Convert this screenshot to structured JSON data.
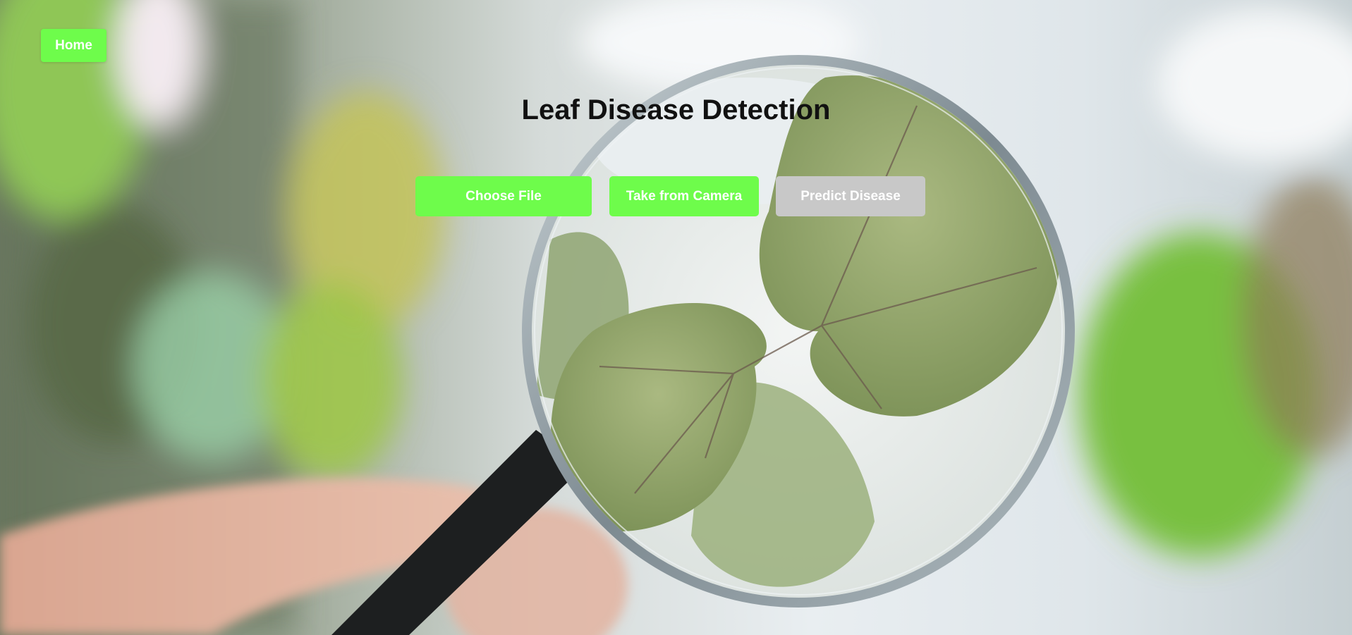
{
  "nav": {
    "home_label": "Home"
  },
  "header": {
    "title": "Leaf Disease Detection"
  },
  "actions": {
    "choose_file_label": "Choose File",
    "camera_label": "Take from Camera",
    "predict_label": "Predict Disease"
  },
  "colors": {
    "accent": "#6efc4b",
    "disabled": "#c8c8c8",
    "title_text": "#111111",
    "button_text": "#ffffff"
  },
  "background": {
    "subject": "magnifying-glass-over-leaf-photo"
  }
}
